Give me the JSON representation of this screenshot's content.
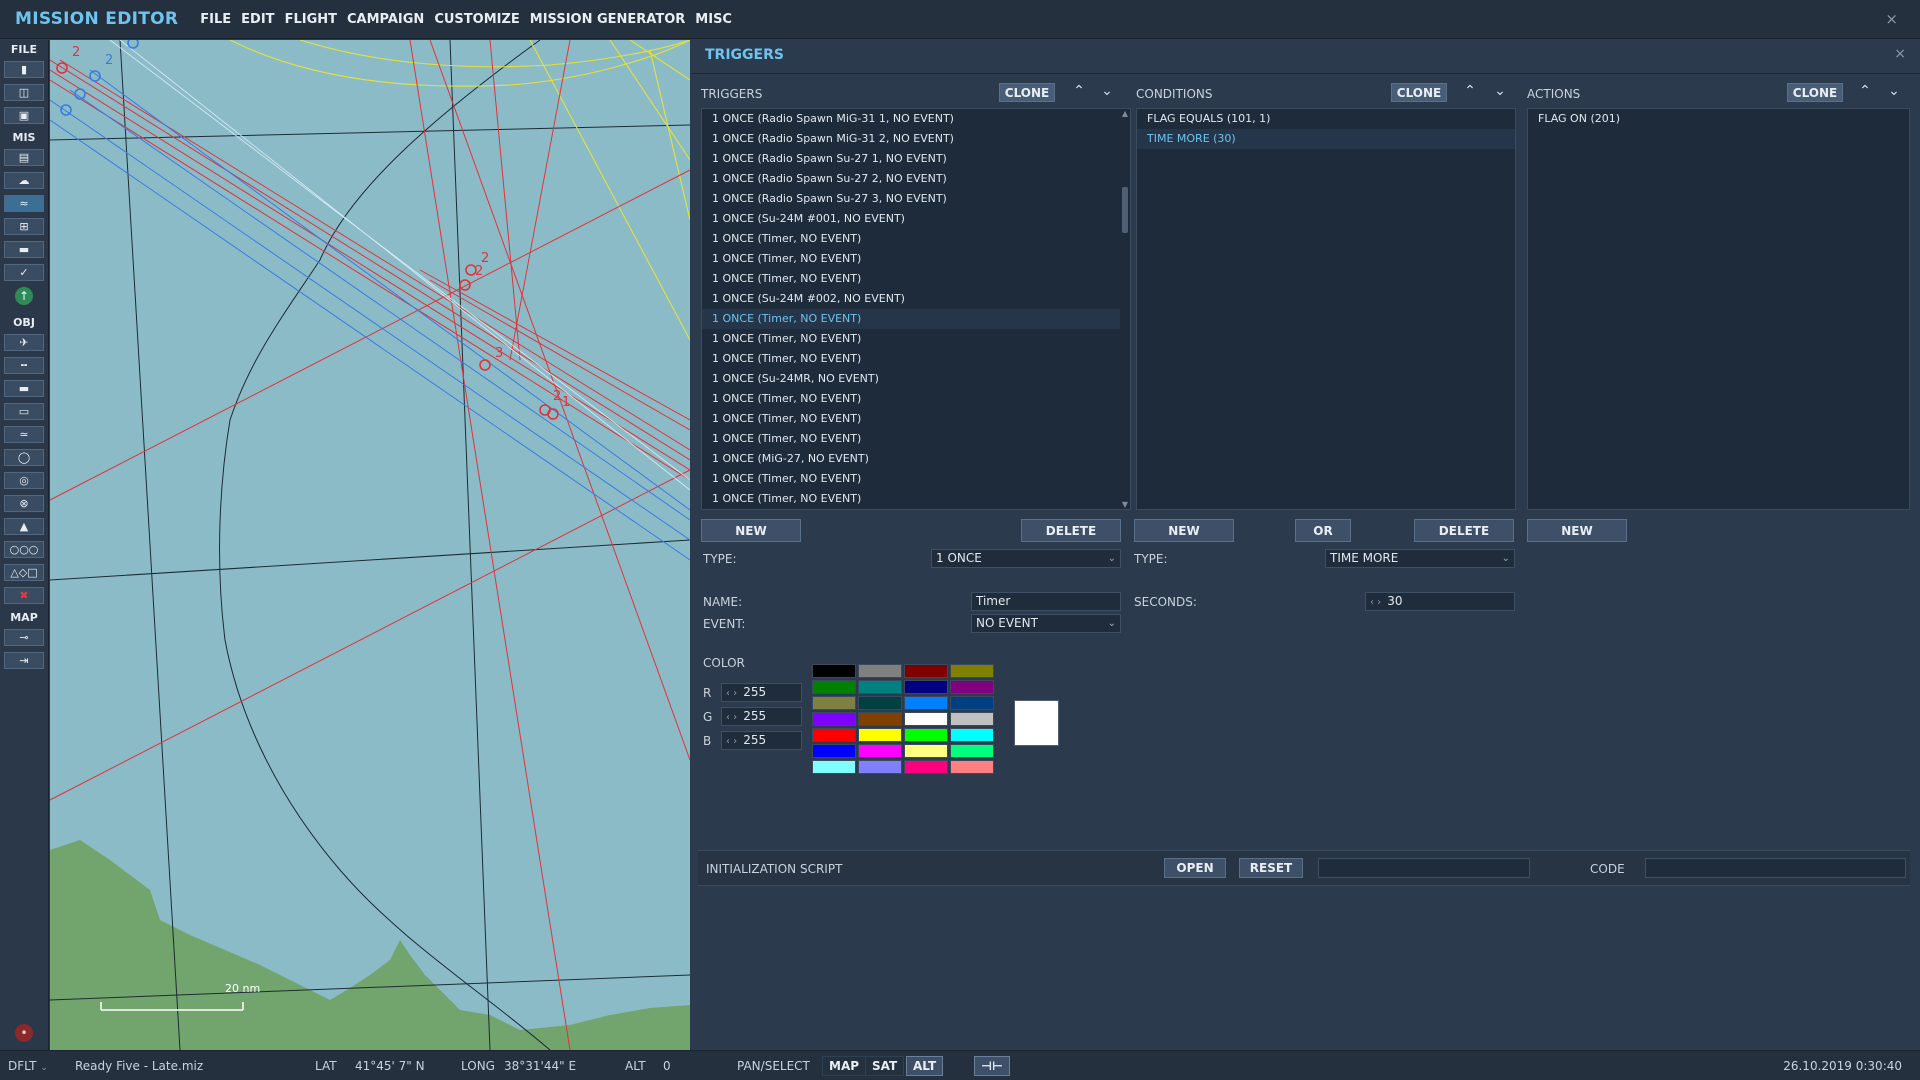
{
  "app": {
    "title": "MISSION EDITOR",
    "menu": [
      "FILE",
      "EDIT",
      "FLIGHT",
      "CAMPAIGN",
      "CUSTOMIZE",
      "MISSION GENERATOR",
      "MISC"
    ],
    "close_icon": "×"
  },
  "toolbar": {
    "sections": {
      "file": "FILE",
      "mis": "MIS",
      "obj": "OBJ",
      "map": "MAP"
    }
  },
  "map": {
    "scale_label": "20 nm",
    "waypoint_labels": [
      "2",
      "2",
      "2",
      "2",
      "3",
      "2",
      "1"
    ]
  },
  "triggers_panel": {
    "title": "TRIGGERS",
    "triggers_label": "TRIGGERS",
    "conditions_label": "CONDITIONS",
    "actions_label": "ACTIONS",
    "clone_label": "CLONE",
    "new_label": "NEW",
    "delete_label": "DELETE",
    "or_label": "OR",
    "triggers": [
      "1 ONCE (Radio Spawn MiG-31 1, NO EVENT)",
      "1 ONCE (Radio Spawn MiG-31 2, NO EVENT)",
      "1 ONCE (Radio Spawn Su-27 1, NO EVENT)",
      "1 ONCE (Radio Spawn Su-27 2, NO EVENT)",
      "1 ONCE (Radio Spawn Su-27 3, NO EVENT)",
      "1 ONCE (Su-24M #001, NO EVENT)",
      "1 ONCE (Timer, NO EVENT)",
      "1 ONCE (Timer, NO EVENT)",
      "1 ONCE (Timer, NO EVENT)",
      "1 ONCE (Su-24M #002, NO EVENT)",
      "1 ONCE (Timer, NO EVENT)",
      "1 ONCE (Timer, NO EVENT)",
      "1 ONCE (Timer, NO EVENT)",
      "1 ONCE (Su-24MR, NO EVENT)",
      "1 ONCE (Timer, NO EVENT)",
      "1 ONCE (Timer, NO EVENT)",
      "1 ONCE (Timer, NO EVENT)",
      "1 ONCE (MiG-27, NO EVENT)",
      "1 ONCE (Timer, NO EVENT)",
      "1 ONCE (Timer, NO EVENT)"
    ],
    "selected_trigger_index": 10,
    "conditions": [
      "FLAG EQUALS (101, 1)",
      "TIME MORE (30)"
    ],
    "selected_condition_index": 1,
    "actions": [
      "FLAG ON (201)"
    ],
    "trigger_form": {
      "type_label": "TYPE:",
      "type_value": "1 ONCE",
      "name_label": "NAME:",
      "name_value": "Timer",
      "event_label": "EVENT:",
      "event_value": "NO EVENT"
    },
    "condition_form": {
      "type_label": "TYPE:",
      "type_value": "TIME MORE",
      "seconds_label": "SECONDS:",
      "seconds_value": "30"
    },
    "color": {
      "label": "COLOR",
      "r_label": "R",
      "r_value": "255",
      "g_label": "G",
      "g_value": "255",
      "b_label": "B",
      "b_value": "255",
      "palette": [
        "#000000",
        "#808080",
        "#800000",
        "#808000",
        "#008000",
        "#008080",
        "#000080",
        "#800080",
        "#808040",
        "#004040",
        "#0080ff",
        "#004080",
        "#8000ff",
        "#804000",
        "#ffffff",
        "#c0c0c0",
        "#ff0000",
        "#ffff00",
        "#00ff00",
        "#00ffff",
        "#0000ff",
        "#ff00ff",
        "#ffff80",
        "#00ff80",
        "#80ffff",
        "#8080ff",
        "#ff0080",
        "#ff8080"
      ],
      "preview": "#ffffff"
    },
    "init_script": {
      "label": "INITIALIZATION SCRIPT",
      "open_label": "OPEN",
      "reset_label": "RESET",
      "code_label": "CODE"
    }
  },
  "statusbar": {
    "profile": "DFLT",
    "file": "Ready Five - Late.miz",
    "lat_label": "LAT",
    "lat_value": "41°45' 7\" N",
    "long_label": "LONG",
    "long_value": "38°31'44\" E",
    "alt_label": "ALT",
    "alt_value": "0",
    "pan_label": "PAN/SELECT",
    "map_btn": "MAP",
    "sat_btn": "SAT",
    "alt_btn": "ALT",
    "datetime": "26.10.2019 0:30:40"
  }
}
